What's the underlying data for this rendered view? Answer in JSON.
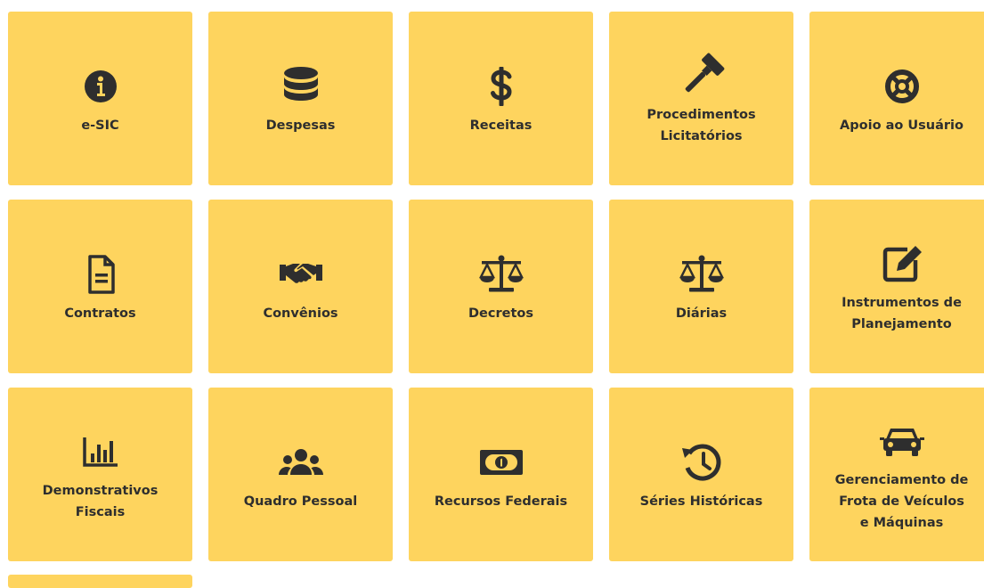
{
  "colors": {
    "tile_background": "#fed45e",
    "icon_and_text": "#2e2e2e"
  },
  "tiles": [
    {
      "label": "e-SIC",
      "icon": "info-circle-icon"
    },
    {
      "label": "Despesas",
      "icon": "database-icon"
    },
    {
      "label": "Receitas",
      "icon": "dollar-sign-icon"
    },
    {
      "label": "Procedimentos\nLicitatórios",
      "icon": "gavel-icon"
    },
    {
      "label": "Apoio ao Usuário",
      "icon": "life-ring-icon"
    },
    {
      "label": "Contratos",
      "icon": "file-document-icon"
    },
    {
      "label": "Convênios",
      "icon": "handshake-icon"
    },
    {
      "label": "Decretos",
      "icon": "balance-scale-icon"
    },
    {
      "label": "Diárias",
      "icon": "balance-scale-icon"
    },
    {
      "label": "Instrumentos de\nPlanejamento",
      "icon": "edit-square-icon"
    },
    {
      "label": "Demonstrativos\nFiscais",
      "icon": "bar-chart-icon"
    },
    {
      "label": "Quadro Pessoal",
      "icon": "users-icon"
    },
    {
      "label": "Recursos Federais",
      "icon": "money-bill-icon"
    },
    {
      "label": "Séries Históricas",
      "icon": "history-icon"
    },
    {
      "label": "Gerenciamento de\nFrota de Veículos\ne Máquinas",
      "icon": "car-icon"
    },
    {
      "label": "",
      "icon": ""
    }
  ]
}
